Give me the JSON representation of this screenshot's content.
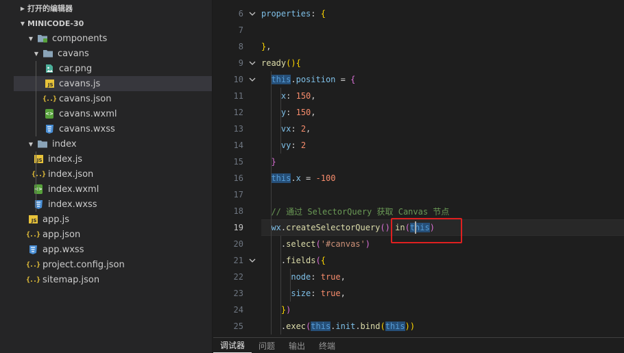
{
  "explorer": {
    "open_editors_label": "打开的编辑器",
    "project_label": "MINICODE-30",
    "tree": [
      {
        "label": "components",
        "icon": "folder-icon",
        "depth": 1,
        "open": true
      },
      {
        "label": "cavans",
        "icon": "folder-icon",
        "depth": 2,
        "open": true
      },
      {
        "label": "car.png",
        "icon": "image-file-icon",
        "depth": 3
      },
      {
        "label": "cavans.js",
        "icon": "js-file-icon",
        "depth": 3,
        "selected": true
      },
      {
        "label": "cavans.json",
        "icon": "json-file-icon",
        "depth": 3
      },
      {
        "label": "cavans.wxml",
        "icon": "wxml-file-icon",
        "depth": 3
      },
      {
        "label": "cavans.wxss",
        "icon": "wxss-file-icon",
        "depth": 3
      },
      {
        "label": "index",
        "icon": "folder-icon",
        "depth": 1,
        "open": true
      },
      {
        "label": "index.js",
        "icon": "js-file-icon",
        "depth": 2
      },
      {
        "label": "index.json",
        "icon": "json-file-icon",
        "depth": 2
      },
      {
        "label": "index.wxml",
        "icon": "wxml-file-icon",
        "depth": 2
      },
      {
        "label": "index.wxss",
        "icon": "wxss-file-icon",
        "depth": 2
      },
      {
        "label": "app.js",
        "icon": "js-file-icon",
        "depth": 1
      },
      {
        "label": "app.json",
        "icon": "json-file-icon",
        "depth": 1
      },
      {
        "label": "app.wxss",
        "icon": "wxss-file-icon",
        "depth": 1
      },
      {
        "label": "project.config.json",
        "icon": "json-file-icon",
        "depth": 1
      },
      {
        "label": "sitemap.json",
        "icon": "json-file-icon",
        "depth": 1
      }
    ]
  },
  "editor": {
    "active_line": "19",
    "lines": [
      {
        "n": "6",
        "fold": true,
        "tokens": [
          [
            "k",
            "properties"
          ],
          [
            "op",
            ": "
          ],
          [
            "br",
            "{"
          ]
        ]
      },
      {
        "n": "7",
        "tokens": []
      },
      {
        "n": "8",
        "tokens": [
          [
            "br",
            "}"
          ],
          [
            "op",
            ","
          ]
        ]
      },
      {
        "n": "9",
        "fold": true,
        "tokens": [
          [
            "fn",
            "ready"
          ],
          [
            "br",
            "(){"
          ]
        ]
      },
      {
        "n": "10",
        "fold": true,
        "tokens": [
          [
            "op",
            "  "
          ],
          [
            "this",
            "this"
          ],
          [
            "op",
            "."
          ],
          [
            "k",
            "position"
          ],
          [
            "op",
            " = "
          ],
          [
            "br2",
            "{"
          ]
        ]
      },
      {
        "n": "11",
        "tokens": [
          [
            "op",
            "    "
          ],
          [
            "k",
            "x"
          ],
          [
            "op",
            ": "
          ],
          [
            "num",
            "150"
          ],
          [
            "op",
            ","
          ]
        ]
      },
      {
        "n": "12",
        "tokens": [
          [
            "op",
            "    "
          ],
          [
            "k",
            "y"
          ],
          [
            "op",
            ": "
          ],
          [
            "num",
            "150"
          ],
          [
            "op",
            ","
          ]
        ]
      },
      {
        "n": "13",
        "tokens": [
          [
            "op",
            "    "
          ],
          [
            "k",
            "vx"
          ],
          [
            "op",
            ": "
          ],
          [
            "num",
            "2"
          ],
          [
            "op",
            ","
          ]
        ]
      },
      {
        "n": "14",
        "tokens": [
          [
            "op",
            "    "
          ],
          [
            "k",
            "vy"
          ],
          [
            "op",
            ": "
          ],
          [
            "num",
            "2"
          ]
        ]
      },
      {
        "n": "15",
        "tokens": [
          [
            "op",
            "  "
          ],
          [
            "br2",
            "}"
          ]
        ]
      },
      {
        "n": "16",
        "tokens": [
          [
            "op",
            "  "
          ],
          [
            "this",
            "this"
          ],
          [
            "op",
            "."
          ],
          [
            "k",
            "x"
          ],
          [
            "op",
            " = "
          ],
          [
            "num",
            "-100"
          ]
        ]
      },
      {
        "n": "17",
        "tokens": []
      },
      {
        "n": "18",
        "tokens": [
          [
            "op",
            "  "
          ],
          [
            "cm",
            "// 通过 SelectorQuery 获取 Canvas 节点"
          ]
        ]
      },
      {
        "n": "19",
        "tokens": [
          [
            "op",
            "  "
          ],
          [
            "k",
            "wx"
          ],
          [
            "op",
            "."
          ],
          [
            "fn",
            "createSelectorQuery"
          ],
          [
            "br2",
            "()"
          ],
          [
            "op",
            " "
          ],
          [
            "fn",
            "in"
          ],
          [
            "br2",
            "("
          ],
          [
            "this",
            "this"
          ],
          [
            "br2",
            ")"
          ]
        ]
      },
      {
        "n": "20",
        "tokens": [
          [
            "op",
            "    ."
          ],
          [
            "fn",
            "select"
          ],
          [
            "br2",
            "("
          ],
          [
            "str",
            "'#canvas'"
          ],
          [
            "br2",
            ")"
          ]
        ]
      },
      {
        "n": "21",
        "fold": true,
        "tokens": [
          [
            "op",
            "    ."
          ],
          [
            "fn",
            "fields"
          ],
          [
            "br2",
            "("
          ],
          [
            "br",
            "{"
          ]
        ]
      },
      {
        "n": "22",
        "tokens": [
          [
            "op",
            "      "
          ],
          [
            "k",
            "node"
          ],
          [
            "op",
            ": "
          ],
          [
            "bool",
            "true"
          ],
          [
            "op",
            ","
          ]
        ]
      },
      {
        "n": "23",
        "tokens": [
          [
            "op",
            "      "
          ],
          [
            "k",
            "size"
          ],
          [
            "op",
            ": "
          ],
          [
            "bool",
            "true"
          ],
          [
            "op",
            ","
          ]
        ]
      },
      {
        "n": "24",
        "tokens": [
          [
            "op",
            "    "
          ],
          [
            "br",
            "}"
          ],
          [
            "br2",
            ")"
          ]
        ]
      },
      {
        "n": "25",
        "tokens": [
          [
            "op",
            "    ."
          ],
          [
            "fn",
            "exec"
          ],
          [
            "br2",
            "("
          ],
          [
            "this",
            "this"
          ],
          [
            "op",
            "."
          ],
          [
            "k",
            "init"
          ],
          [
            "op",
            "."
          ],
          [
            "fn",
            "bind"
          ],
          [
            "br",
            "("
          ],
          [
            "this",
            "this"
          ],
          [
            "br",
            "))"
          ]
        ]
      }
    ]
  },
  "panel": {
    "tabs": [
      "调试器",
      "问题",
      "输出",
      "终端"
    ],
    "active_tab": "调试器"
  }
}
